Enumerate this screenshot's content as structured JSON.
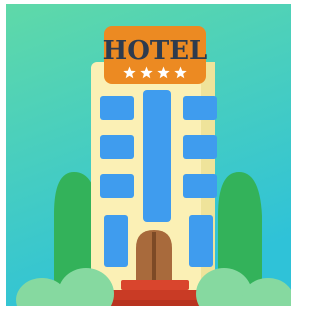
{
  "app_icon": {
    "name": "Hotel icon",
    "sign": {
      "label": "HOTEL",
      "stars": 4
    },
    "colors": {
      "background_top": "#5fd9a8",
      "background_bottom": "#2fc2d8",
      "building": "#fbf0b5",
      "building_side": "#efe39a",
      "window": "#3f9cee",
      "sign_board": "#ec8a22",
      "sign_text": "#2e3b4e",
      "star": "#ffffff",
      "door": "#a86a3c",
      "door_dark": "#7d4a26",
      "steps": "#d9452d",
      "tree_dark": "#33b25a",
      "tree_light": "#86d9a0"
    }
  }
}
